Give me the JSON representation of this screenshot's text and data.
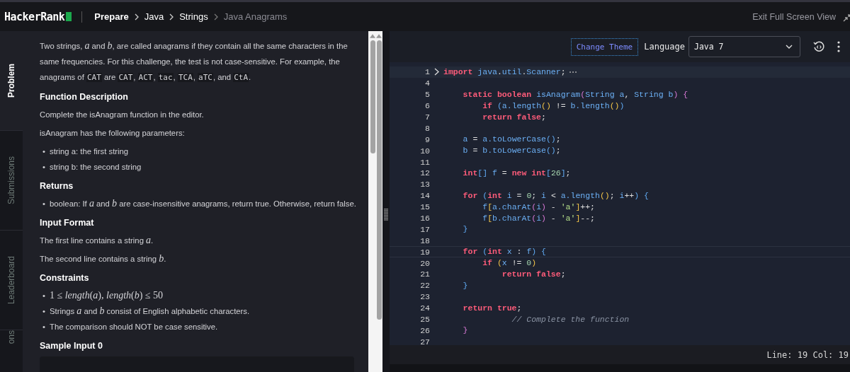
{
  "topbar": {
    "logo": "HackerRank",
    "breadcrumb": [
      {
        "label": "Prepare",
        "current": false
      },
      {
        "label": "Java",
        "current": false
      },
      {
        "label": "Strings",
        "current": false
      },
      {
        "label": "Java Anagrams",
        "current": true
      }
    ],
    "exit_label": "Exit Full Screen View"
  },
  "side_tabs": [
    {
      "label": "Problem",
      "selected": true
    },
    {
      "label": "Submissions",
      "selected": false
    },
    {
      "label": "Leaderboard",
      "selected": false
    },
    {
      "label": "ons",
      "selected": false
    }
  ],
  "problem": [
    {
      "kind": "paragraph",
      "segments": [
        {
          "kind": "text",
          "text": "Two strings, "
        },
        {
          "kind": "math",
          "text": "a"
        },
        {
          "kind": "text",
          "text": " and "
        },
        {
          "kind": "math",
          "text": "b"
        },
        {
          "kind": "text",
          "text": ", are called anagrams if they contain all the same characters in the same frequencies. For this challenge, the test is not case-sensitive. For example, the anagrams of "
        },
        {
          "kind": "code",
          "text": "CAT"
        },
        {
          "kind": "text",
          "text": " are "
        },
        {
          "kind": "code",
          "text": "CAT"
        },
        {
          "kind": "text",
          "text": ", "
        },
        {
          "kind": "code",
          "text": "ACT"
        },
        {
          "kind": "text",
          "text": ", "
        },
        {
          "kind": "code",
          "text": "tac"
        },
        {
          "kind": "text",
          "text": ", "
        },
        {
          "kind": "code",
          "text": "TCA"
        },
        {
          "kind": "text",
          "text": ", "
        },
        {
          "kind": "code",
          "text": "aTC"
        },
        {
          "kind": "text",
          "text": ", and "
        },
        {
          "kind": "code",
          "text": "CtA"
        },
        {
          "kind": "text",
          "text": "."
        }
      ]
    },
    {
      "kind": "heading",
      "text": "Function Description"
    },
    {
      "kind": "paragraph",
      "segments": [
        {
          "kind": "text",
          "text": "Complete the isAnagram function in the editor."
        }
      ]
    },
    {
      "kind": "paragraph",
      "segments": [
        {
          "kind": "text",
          "text": "isAnagram has the following parameters:"
        }
      ]
    },
    {
      "kind": "bullets",
      "items": [
        {
          "marker": "•",
          "segments": [
            {
              "kind": "text",
              "text": "string a: the first string"
            }
          ]
        },
        {
          "marker": "•",
          "segments": [
            {
              "kind": "text",
              "text": "string b: the second string"
            }
          ]
        }
      ]
    },
    {
      "kind": "heading",
      "text": "Returns"
    },
    {
      "kind": "bullets",
      "items": [
        {
          "marker": "•",
          "segments": [
            {
              "kind": "text",
              "text": "boolean: If "
            },
            {
              "kind": "math",
              "text": "a"
            },
            {
              "kind": "text",
              "text": " and "
            },
            {
              "kind": "math",
              "text": "b"
            },
            {
              "kind": "text",
              "text": " are case-insensitive anagrams, return true. Otherwise, return false."
            }
          ]
        }
      ]
    },
    {
      "kind": "heading",
      "text": "Input Format"
    },
    {
      "kind": "paragraph",
      "segments": [
        {
          "kind": "text",
          "text": "The first line contains a string "
        },
        {
          "kind": "math",
          "text": "a"
        },
        {
          "kind": "text",
          "text": "."
        }
      ]
    },
    {
      "kind": "paragraph",
      "segments": [
        {
          "kind": "text",
          "text": "The second line contains a string "
        },
        {
          "kind": "math",
          "text": "b"
        },
        {
          "kind": "text",
          "text": "."
        }
      ]
    },
    {
      "kind": "heading",
      "text": "Constraints"
    },
    {
      "kind": "bullets",
      "items": [
        {
          "marker": "•",
          "segments": [
            {
              "kind": "mathup",
              "text": "1 ≤ "
            },
            {
              "kind": "math",
              "text": "length"
            },
            {
              "kind": "mathup",
              "text": "("
            },
            {
              "kind": "math",
              "text": "a"
            },
            {
              "kind": "mathup",
              "text": "), "
            },
            {
              "kind": "math",
              "text": "length"
            },
            {
              "kind": "mathup",
              "text": "("
            },
            {
              "kind": "math",
              "text": "b"
            },
            {
              "kind": "mathup",
              "text": ") ≤ 50"
            }
          ]
        },
        {
          "marker": "•",
          "segments": [
            {
              "kind": "text",
              "text": "Strings "
            },
            {
              "kind": "math",
              "text": "a"
            },
            {
              "kind": "text",
              "text": " and "
            },
            {
              "kind": "math",
              "text": "b"
            },
            {
              "kind": "text",
              "text": " consist of English alphabetic characters."
            }
          ]
        },
        {
          "marker": "•",
          "segments": [
            {
              "kind": "text",
              "text": "The comparison should NOT be case sensitive."
            }
          ]
        }
      ]
    },
    {
      "kind": "heading",
      "text": "Sample Input 0"
    },
    {
      "kind": "sample_box"
    }
  ],
  "editor": {
    "theme_button": "Change Theme",
    "language_label": "Language",
    "language": "Java 7",
    "lines": [
      {
        "number": "1",
        "folded": true,
        "current": false,
        "tokens": [
          {
            "kind": "kw",
            "text": "import"
          },
          {
            "kind": "id",
            "text": " java"
          },
          {
            "kind": "op",
            "text": "."
          },
          {
            "kind": "id",
            "text": "util"
          },
          {
            "kind": "op",
            "text": "."
          },
          {
            "kind": "id",
            "text": "Scanner"
          },
          {
            "kind": "op",
            "text": ";"
          }
        ]
      },
      {
        "number": "4",
        "folded": false,
        "current": false
      },
      {
        "number": "5",
        "folded": false,
        "current": false,
        "tokens": [
          {
            "kind": "kw",
            "text": "    static boolean"
          },
          {
            "kind": "id",
            "text": " isAnagram"
          },
          {
            "kind": "bp",
            "text": "("
          },
          {
            "kind": "id",
            "text": "String a"
          },
          {
            "kind": "op",
            "text": ", "
          },
          {
            "kind": "id",
            "text": "String b"
          },
          {
            "kind": "bp",
            "text": ")"
          },
          {
            "kind": "bp",
            "text": " {"
          }
        ]
      },
      {
        "number": "6",
        "folded": false,
        "current": false,
        "tokens": [
          {
            "kind": "kw",
            "text": "        if"
          },
          {
            "kind": "bb",
            "text": " ("
          },
          {
            "kind": "id",
            "text": "a.length"
          },
          {
            "kind": "by",
            "text": "()"
          },
          {
            "kind": "op",
            "text": " != "
          },
          {
            "kind": "id",
            "text": "b.length"
          },
          {
            "kind": "by",
            "text": "()"
          },
          {
            "kind": "bb",
            "text": ")"
          }
        ]
      },
      {
        "number": "7",
        "folded": false,
        "current": false,
        "tokens": [
          {
            "kind": "kw",
            "text": "        return false"
          },
          {
            "kind": "op",
            "text": ";"
          }
        ]
      },
      {
        "number": "8",
        "folded": false,
        "current": false
      },
      {
        "number": "9",
        "folded": false,
        "current": false,
        "tokens": [
          {
            "kind": "id",
            "text": "    a"
          },
          {
            "kind": "op",
            "text": " = "
          },
          {
            "kind": "id",
            "text": "a.toLowerCase"
          },
          {
            "kind": "bb",
            "text": "()"
          },
          {
            "kind": "op",
            "text": ";"
          }
        ]
      },
      {
        "number": "10",
        "folded": false,
        "current": false,
        "tokens": [
          {
            "kind": "id",
            "text": "    b"
          },
          {
            "kind": "op",
            "text": " = "
          },
          {
            "kind": "id",
            "text": "b.toLowerCase"
          },
          {
            "kind": "bb",
            "text": "()"
          },
          {
            "kind": "op",
            "text": ";"
          }
        ]
      },
      {
        "number": "11",
        "folded": false,
        "current": false
      },
      {
        "number": "12",
        "folded": false,
        "current": false,
        "tokens": [
          {
            "kind": "kw",
            "text": "    int"
          },
          {
            "kind": "bb",
            "text": "[]"
          },
          {
            "kind": "id",
            "text": " f"
          },
          {
            "kind": "op",
            "text": " = "
          },
          {
            "kind": "kw",
            "text": "new int"
          },
          {
            "kind": "bb",
            "text": "["
          },
          {
            "kind": "num",
            "text": "26"
          },
          {
            "kind": "bb",
            "text": "]"
          },
          {
            "kind": "op",
            "text": ";"
          }
        ]
      },
      {
        "number": "13",
        "folded": false,
        "current": false
      },
      {
        "number": "14",
        "folded": false,
        "current": false,
        "tokens": [
          {
            "kind": "kw",
            "text": "    for"
          },
          {
            "kind": "bb",
            "text": " ("
          },
          {
            "kind": "kw",
            "text": "int"
          },
          {
            "kind": "id",
            "text": " i"
          },
          {
            "kind": "op",
            "text": " = "
          },
          {
            "kind": "num",
            "text": "0"
          },
          {
            "kind": "op",
            "text": "; "
          },
          {
            "kind": "id",
            "text": "i"
          },
          {
            "kind": "op",
            "text": " < "
          },
          {
            "kind": "id",
            "text": "a.length"
          },
          {
            "kind": "by",
            "text": "()"
          },
          {
            "kind": "op",
            "text": "; "
          },
          {
            "kind": "id",
            "text": "i"
          },
          {
            "kind": "op",
            "text": "++"
          },
          {
            "kind": "bb",
            "text": ")"
          },
          {
            "kind": "bb",
            "text": " {"
          }
        ]
      },
      {
        "number": "15",
        "folded": false,
        "current": false,
        "tokens": [
          {
            "kind": "id",
            "text": "        f"
          },
          {
            "kind": "by",
            "text": "["
          },
          {
            "kind": "id",
            "text": "a.charAt"
          },
          {
            "kind": "bp",
            "text": "("
          },
          {
            "kind": "id",
            "text": "i"
          },
          {
            "kind": "bp",
            "text": ")"
          },
          {
            "kind": "op",
            "text": " - "
          },
          {
            "kind": "str",
            "text": "'a'"
          },
          {
            "kind": "by",
            "text": "]"
          },
          {
            "kind": "op",
            "text": "++;"
          }
        ]
      },
      {
        "number": "16",
        "folded": false,
        "current": false,
        "tokens": [
          {
            "kind": "id",
            "text": "        f"
          },
          {
            "kind": "by",
            "text": "["
          },
          {
            "kind": "id",
            "text": "b.charAt"
          },
          {
            "kind": "bp",
            "text": "("
          },
          {
            "kind": "id",
            "text": "i"
          },
          {
            "kind": "bp",
            "text": ")"
          },
          {
            "kind": "op",
            "text": " - "
          },
          {
            "kind": "str",
            "text": "'a'"
          },
          {
            "kind": "by",
            "text": "]"
          },
          {
            "kind": "op",
            "text": "--;"
          }
        ]
      },
      {
        "number": "17",
        "folded": false,
        "current": false,
        "tokens": [
          {
            "kind": "bb",
            "text": "    }"
          }
        ]
      },
      {
        "number": "18",
        "folded": false,
        "current": false
      },
      {
        "number": "19",
        "folded": false,
        "current": true,
        "tokens": [
          {
            "kind": "kw",
            "text": "    for"
          },
          {
            "kind": "bb",
            "text": " ("
          },
          {
            "kind": "kw",
            "text": "int"
          },
          {
            "kind": "id",
            "text": " x"
          },
          {
            "kind": "op",
            "text": " : "
          },
          {
            "kind": "id",
            "text": "f"
          },
          {
            "kind": "bb",
            "text": ")"
          },
          {
            "kind": "bb",
            "text": " {"
          }
        ]
      },
      {
        "number": "20",
        "folded": false,
        "current": false,
        "tokens": [
          {
            "kind": "kw",
            "text": "        if"
          },
          {
            "kind": "by",
            "text": " ("
          },
          {
            "kind": "id",
            "text": "x"
          },
          {
            "kind": "op",
            "text": " != "
          },
          {
            "kind": "num",
            "text": "0"
          },
          {
            "kind": "by",
            "text": ")"
          }
        ]
      },
      {
        "number": "21",
        "folded": false,
        "current": false,
        "tokens": [
          {
            "kind": "kw",
            "text": "            return false"
          },
          {
            "kind": "op",
            "text": ";"
          }
        ]
      },
      {
        "number": "22",
        "folded": false,
        "current": false,
        "tokens": [
          {
            "kind": "bb",
            "text": "    }"
          }
        ]
      },
      {
        "number": "23",
        "folded": false,
        "current": false
      },
      {
        "number": "24",
        "folded": false,
        "current": false,
        "tokens": [
          {
            "kind": "kw",
            "text": "    return true"
          },
          {
            "kind": "op",
            "text": ";"
          }
        ]
      },
      {
        "number": "25",
        "folded": false,
        "current": false,
        "tokens": [
          {
            "kind": "cm",
            "text": "              // Complete the function"
          }
        ]
      },
      {
        "number": "26",
        "folded": false,
        "current": false,
        "tokens": [
          {
            "kind": "bp",
            "text": "    }"
          }
        ]
      },
      {
        "number": "27",
        "folded": false,
        "current": false
      }
    ],
    "status": "Line: 19 Col: 19"
  }
}
